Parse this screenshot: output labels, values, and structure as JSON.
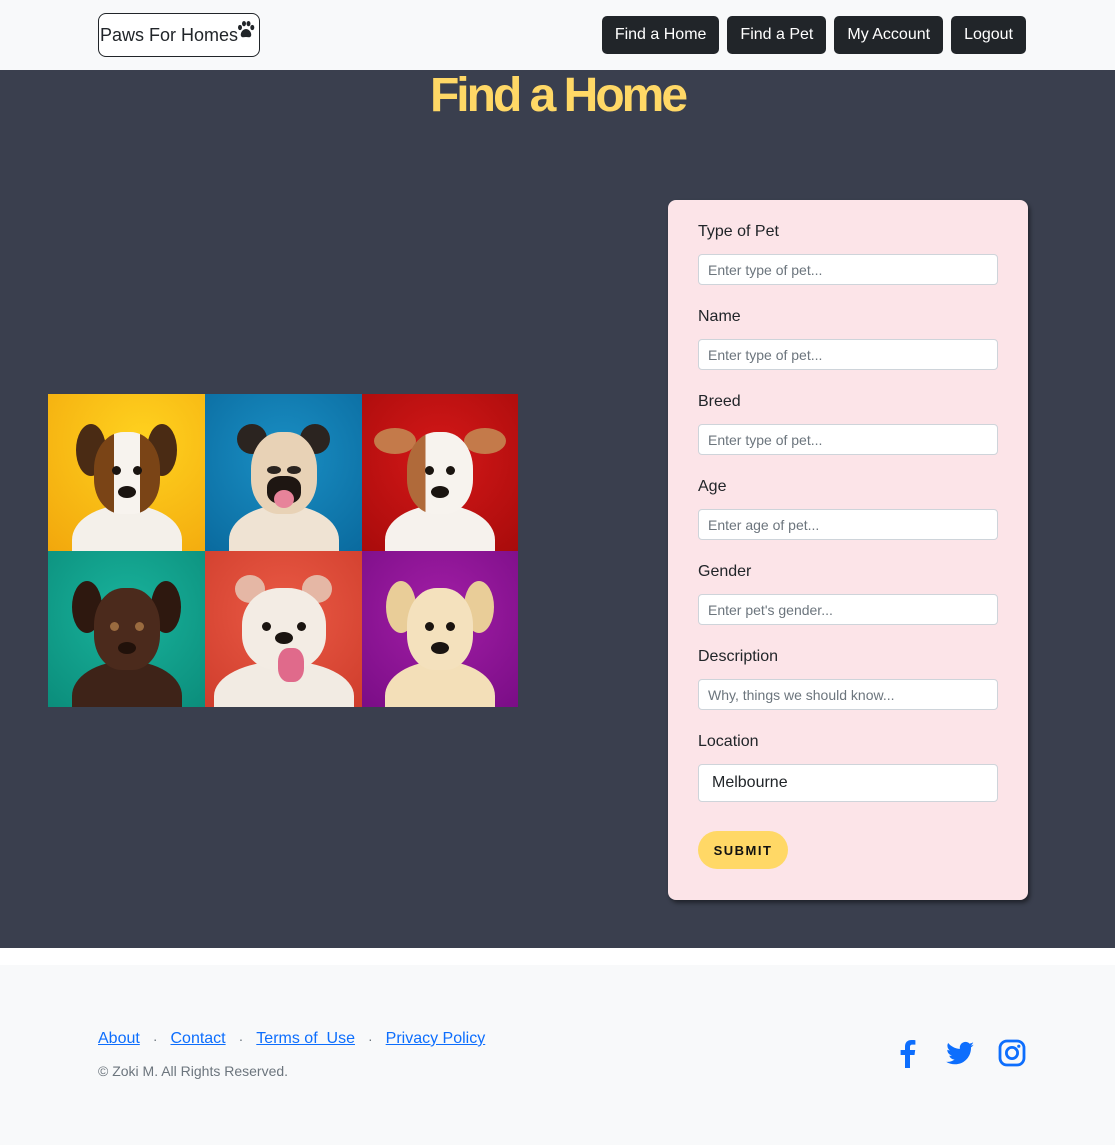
{
  "navbar": {
    "brand": "Paws For Homes",
    "brand_icon": "paw-icon",
    "buttons": [
      "Find a Home",
      "Find a Pet",
      "My Account",
      "Logout"
    ]
  },
  "hero": {
    "title": "Find a Home",
    "image_icon": "puppies-collage-image"
  },
  "form": {
    "fields": [
      {
        "label": "Type of Pet",
        "placeholder": "Enter type of pet...",
        "value": ""
      },
      {
        "label": "Name",
        "placeholder": "Enter type of pet...",
        "value": ""
      },
      {
        "label": "Breed",
        "placeholder": "Enter type of pet...",
        "value": ""
      },
      {
        "label": "Age",
        "placeholder": "Enter age of pet...",
        "value": ""
      },
      {
        "label": "Gender",
        "placeholder": "Enter pet's gender...",
        "value": ""
      },
      {
        "label": "Description",
        "placeholder": "Why, things we should know...",
        "value": ""
      },
      {
        "label": "Location",
        "placeholder": "",
        "value": "Melbourne"
      }
    ],
    "submit_label": "SUBMIT"
  },
  "footer": {
    "links": [
      "About",
      "Contact",
      "Terms of  Use",
      "Privacy Policy"
    ],
    "separator": "·",
    "copyright": "© Zoki M. All Rights Reserved.",
    "socials": [
      "facebook-icon",
      "twitter-icon",
      "instagram-icon"
    ]
  },
  "colors": {
    "accent_yellow": "#ffd866",
    "hero_bg": "#3a3f4e",
    "form_bg": "#fce4e8",
    "link_blue": "#0d6efd",
    "nav_button": "#212529"
  }
}
